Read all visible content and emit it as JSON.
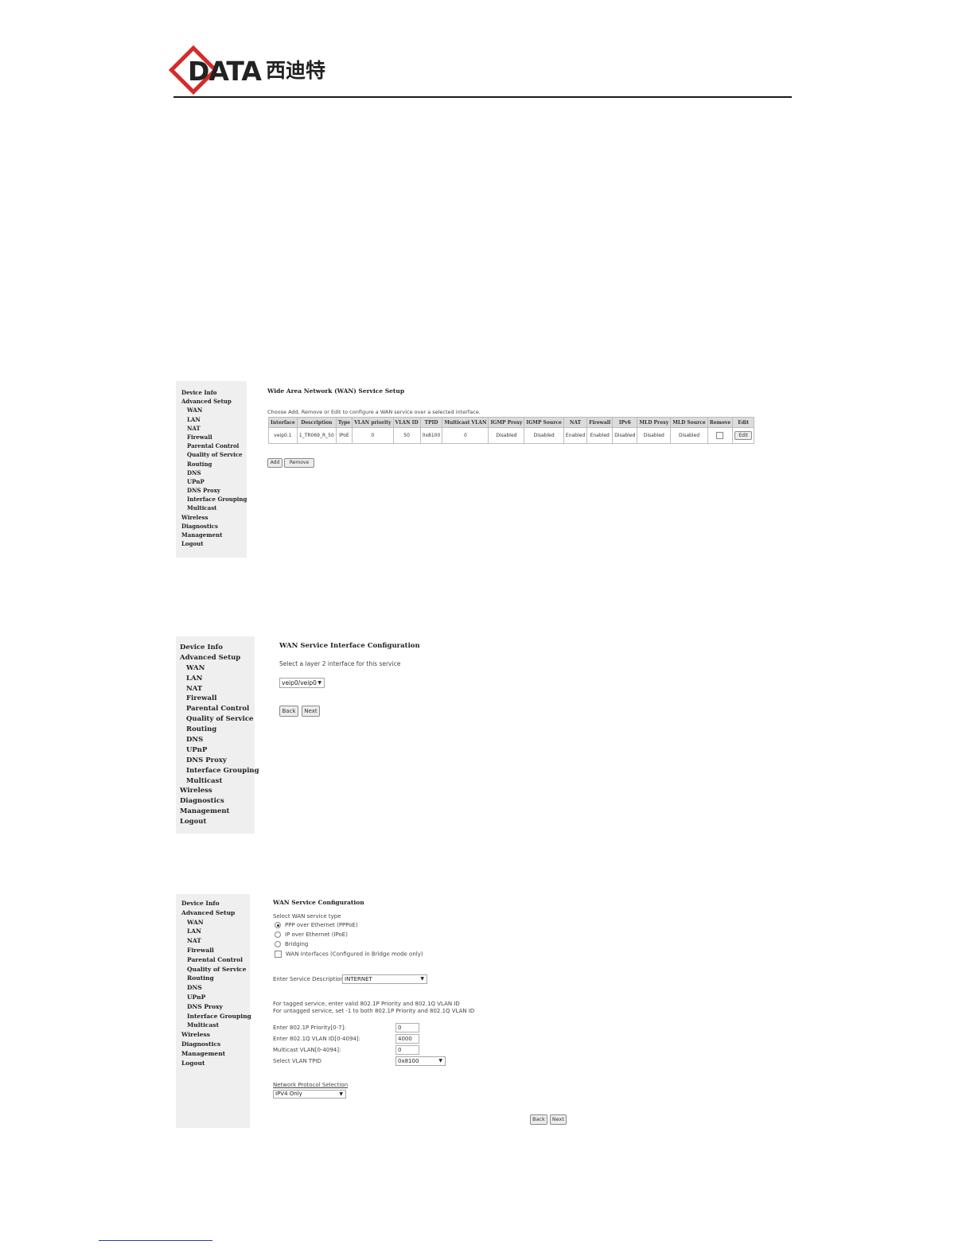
{
  "header": {
    "logo_text": "DATA",
    "logo_cn": "西迪特",
    "brand_color": "#d42b2b"
  },
  "sidebar": {
    "items": [
      {
        "label": "Device Info",
        "sub": false
      },
      {
        "label": "Advanced Setup",
        "sub": false
      },
      {
        "label": "WAN",
        "sub": true
      },
      {
        "label": "LAN",
        "sub": true
      },
      {
        "label": "NAT",
        "sub": true
      },
      {
        "label": "Firewall",
        "sub": true
      },
      {
        "label": "Parental Control",
        "sub": true
      },
      {
        "label": "Quality of Service",
        "sub": true
      },
      {
        "label": "Routing",
        "sub": true
      },
      {
        "label": "DNS",
        "sub": true
      },
      {
        "label": "UPnP",
        "sub": true
      },
      {
        "label": "DNS Proxy",
        "sub": true
      },
      {
        "label": "Interface Grouping",
        "sub": true
      },
      {
        "label": "Multicast",
        "sub": true
      },
      {
        "label": "Wireless",
        "sub": false
      },
      {
        "label": "Diagnostics",
        "sub": false
      },
      {
        "label": "Management",
        "sub": false
      },
      {
        "label": "Logout",
        "sub": false
      }
    ]
  },
  "panel1": {
    "title": "Wide Area Network (WAN) Service Setup",
    "description": "Choose Add, Remove or Edit to configure a WAN service over a selected interface.",
    "columns": [
      "Interface",
      "Description",
      "Type",
      "VLAN priority",
      "VLAN ID",
      "TPID",
      "Multicast VLAN",
      "IGMP Proxy",
      "IGMP Source",
      "NAT",
      "Firewall",
      "IPv6",
      "MLD Proxy",
      "MLD Source",
      "Remove",
      "Edit"
    ],
    "row": [
      "veip0.1",
      "1_TR069_R_50",
      "IPoE",
      "0",
      "50",
      "0x8100",
      "0",
      "Disabled",
      "Disabled",
      "Enabled",
      "Enabled",
      "Disabled",
      "Disabled",
      "Disabled"
    ],
    "edit_label": "Edit",
    "add_label": "Add",
    "remove_label": "Remove"
  },
  "panel2": {
    "title": "WAN Service Interface Configuration",
    "description": "Select a layer 2 interface for this service",
    "selected_interface": "veip0/veip0",
    "back_label": "Back",
    "next_label": "Next"
  },
  "panel3": {
    "title": "WAN Service Configuration",
    "service_type_label": "Select WAN service type",
    "service_types": [
      {
        "label": "PPP over Ethernet (PPPoE)",
        "checked": true
      },
      {
        "label": "IP over Ethernet (IPoE)",
        "checked": false
      },
      {
        "label": "Bridging",
        "checked": false
      }
    ],
    "wan_interfaces_label": "WAN Interfaces (Configured in Bridge mode only)",
    "service_desc_label": "Enter Service Description",
    "service_desc_value": "INTERNET",
    "tagged_note": "For tagged service, enter valid 802.1P Priority and 802.1Q VLAN ID",
    "untagged_note": "For untagged service, set -1 to both 802.1P Priority and 802.1Q VLAN ID",
    "priority_label": "Enter 802.1P Priority[0-7]:",
    "priority_value": "0",
    "vlan_label": "Enter 802.1Q VLAN ID[0-4094]:",
    "vlan_value": "4000",
    "mcast_label": "Multicast VLAN[0-4094]:",
    "mcast_value": "0",
    "tpid_label": "Select VLAN TPID",
    "tpid_value": "0x8100",
    "protocol_label": "Network Protocol Selection",
    "protocol_value": "IPV4 Only",
    "back_label": "Back",
    "next_label": "Next"
  }
}
